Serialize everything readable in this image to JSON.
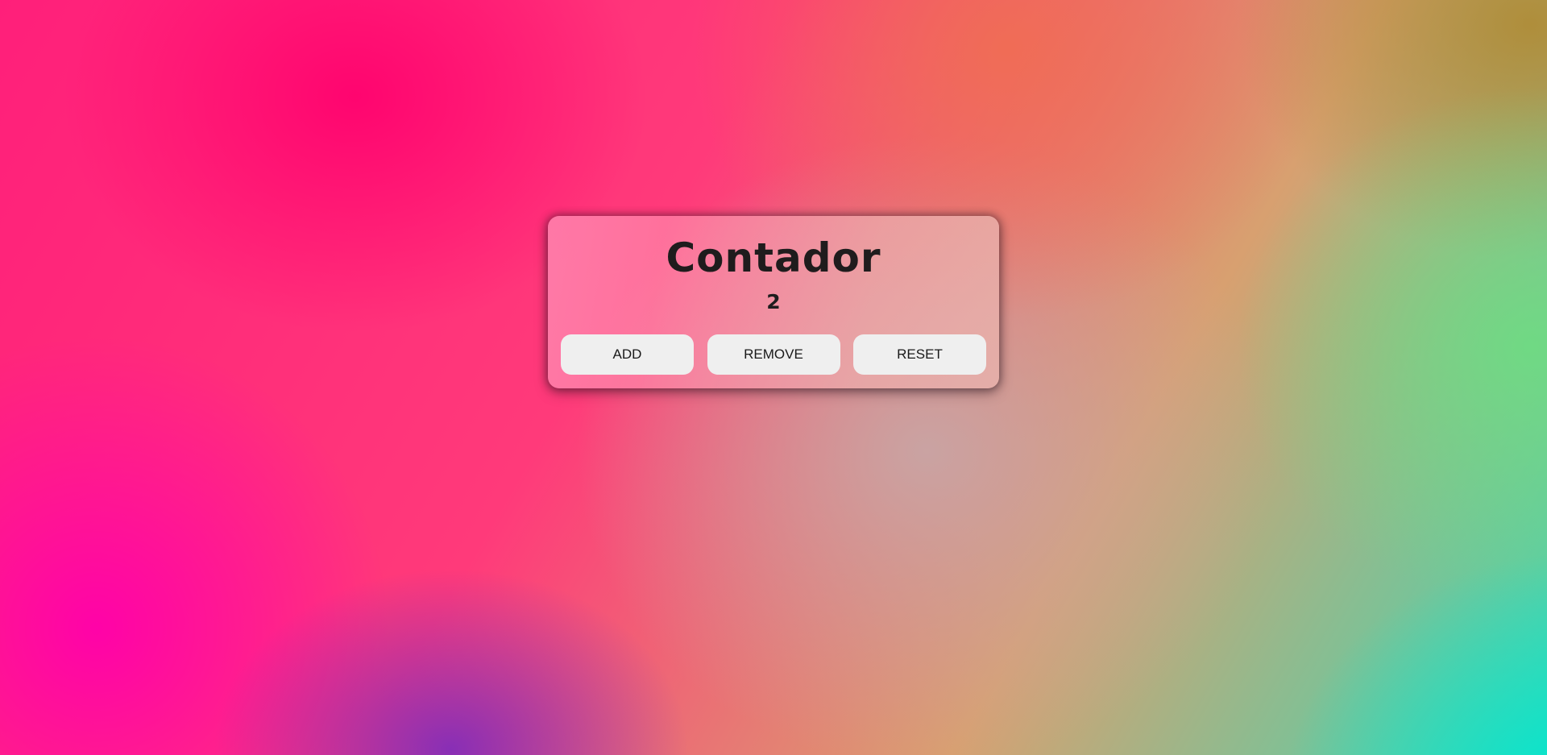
{
  "counter": {
    "title": "Contador",
    "value": "2",
    "buttons": {
      "add_label": "ADD",
      "remove_label": "REMOVE",
      "reset_label": "RESET"
    }
  },
  "colors": {
    "card_text": "#1f1c1d",
    "button_bg": "#efefef",
    "button_text": "#1a1a1a"
  }
}
